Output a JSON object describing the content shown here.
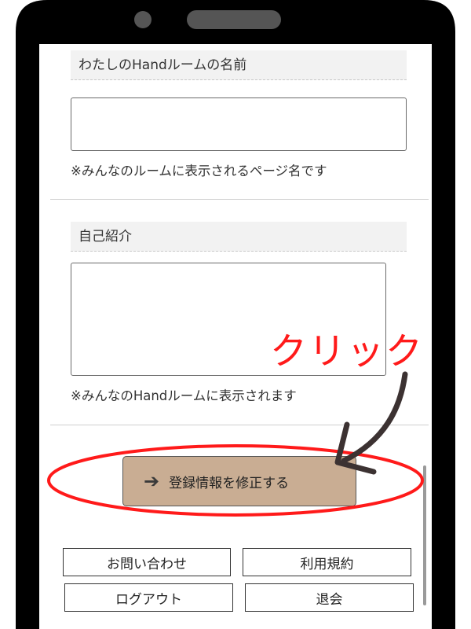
{
  "form": {
    "room_name": {
      "label": "わたしのHandルームの名前",
      "value": "",
      "note": "※みんなのルームに表示されるページ名です"
    },
    "bio": {
      "label": "自己紹介",
      "value": "",
      "note": "※みんなのHandルームに表示されます"
    },
    "submit_label": "登録情報を修正する"
  },
  "footer_links": {
    "contact": "お問い合わせ",
    "terms": "利用規約",
    "logout": "ログアウト",
    "withdraw": "退会"
  },
  "annotation": {
    "text": "クリック",
    "color": "#ff1a1a"
  },
  "colors": {
    "submit_button_bg": "#c9ad93",
    "label_bg": "#f2f2f2",
    "phone_frame": "#000000"
  }
}
